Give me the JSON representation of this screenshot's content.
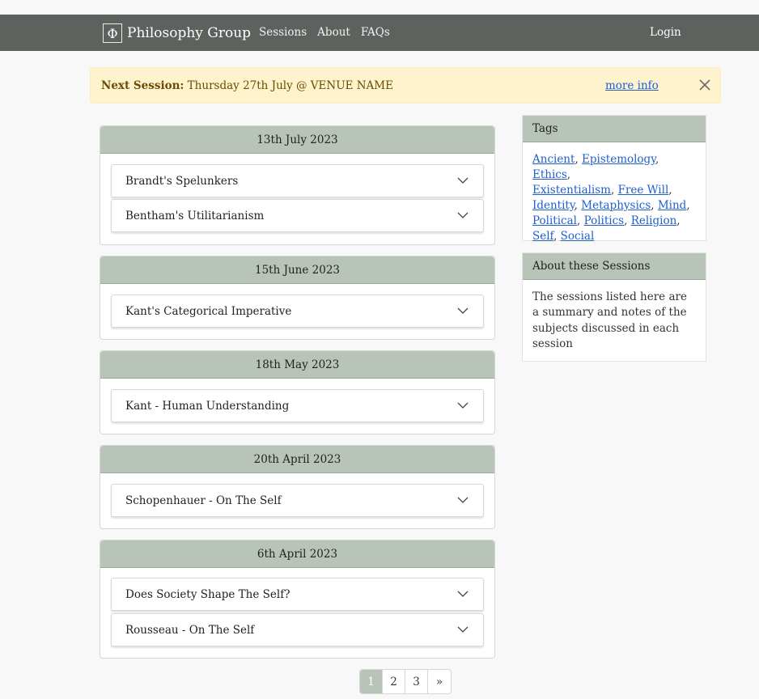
{
  "navbar": {
    "logo_glyph": "Φ",
    "brand": "Philosophy Group",
    "links": [
      "Sessions",
      "About",
      "FAQs"
    ],
    "login": "Login"
  },
  "alert": {
    "label": "Next Session:",
    "text": " Thursday 27th July @ VENUE NAME",
    "more_info": "more info",
    "close_icon": "close-icon"
  },
  "sessions": [
    {
      "date": "13th July 2023",
      "items": [
        "Brandt's Spelunkers",
        "Bentham's Utilitarianism"
      ]
    },
    {
      "date": "15th June 2023",
      "items": [
        "Kant's Categorical Imperative"
      ]
    },
    {
      "date": "18th May 2023",
      "items": [
        "Kant - Human Understanding"
      ]
    },
    {
      "date": "20th April 2023",
      "items": [
        "Schopenhauer - On The Self"
      ]
    },
    {
      "date": "6th April 2023",
      "items": [
        "Does Society Shape The Self?",
        "Rousseau - On The Self"
      ]
    }
  ],
  "sidebar": {
    "tags_title": "Tags",
    "tags": [
      "Ancient",
      "Epistemology",
      "Ethics",
      "Existentialism",
      "Free Will",
      "Identity",
      "Metaphysics",
      "Mind",
      "Political",
      "Politics",
      "Religion",
      "Self",
      "Social"
    ],
    "about_title": "About these Sessions",
    "about_text": "The sessions listed here are a summary and notes of the subjects discussed in each session"
  },
  "pagination": {
    "pages": [
      "1",
      "2",
      "3"
    ],
    "next": "»",
    "current": "1"
  },
  "colors": {
    "navbar": "#5e625e",
    "accent": "#b9c4b8",
    "alert_bg": "#fff3cd",
    "link": "#1f5fcf"
  }
}
